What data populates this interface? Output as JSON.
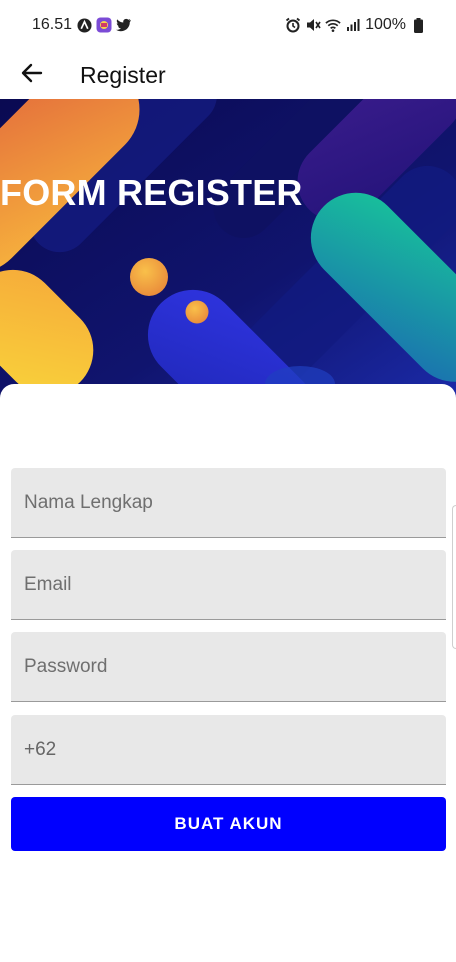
{
  "status_bar": {
    "time": "16.51",
    "battery": "100%",
    "left_icons": [
      "app-a-icon",
      "app-badge-icon",
      "twitter-icon"
    ],
    "right_icons": [
      "alarm-icon",
      "mute-icon",
      "wifi-icon",
      "signal-icon",
      "battery-icon"
    ]
  },
  "app_bar": {
    "title": "Register",
    "back_icon": "arrow-left-icon"
  },
  "banner": {
    "title": "FORM REGISTER",
    "colors": {
      "background": "#0b0a5e",
      "orange": "#f39c3b",
      "yellow": "#f6c83d",
      "teal": "#16b694",
      "blue": "#2a2fd6",
      "purple": "#3a1a8a"
    }
  },
  "form": {
    "full_name": {
      "placeholder": "Nama Lengkap",
      "value": ""
    },
    "email": {
      "placeholder": "Email",
      "value": ""
    },
    "password": {
      "placeholder": "Password",
      "value": ""
    },
    "phone": {
      "placeholder": "",
      "value": "+62"
    },
    "submit_label": "BUAT AKUN"
  },
  "colors": {
    "accent": "#0000ff",
    "field_bg": "#e8e8e8"
  }
}
